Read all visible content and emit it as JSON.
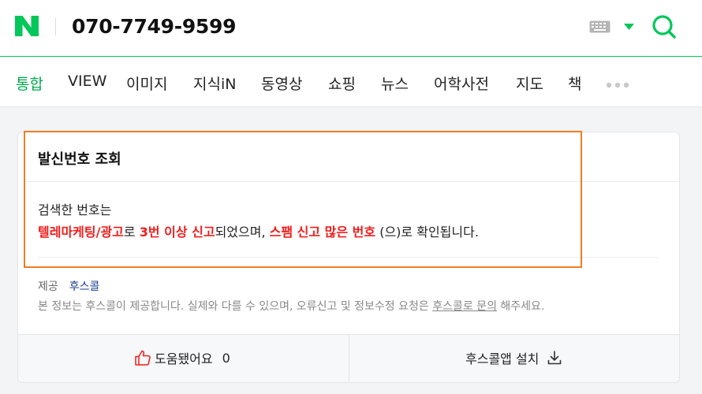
{
  "header": {
    "logo_letter": "N",
    "query": "070-7749-9599",
    "brand_color": "#03c75a"
  },
  "tabs": [
    {
      "label": "통합",
      "active": true
    },
    {
      "label": "VIEW"
    },
    {
      "label": "이미지"
    },
    {
      "label": "지식iN"
    },
    {
      "label": "동영상"
    },
    {
      "label": "쇼핑"
    },
    {
      "label": "뉴스"
    },
    {
      "label": "어학사전"
    },
    {
      "label": "지도"
    },
    {
      "label": "책"
    }
  ],
  "card": {
    "title": "발신번호 조회",
    "line1": "검색한 번호는",
    "line2": {
      "part1": "텔레마케팅/광고",
      "part2": "로 ",
      "part3": "3번 이상 신고",
      "part4": "되었으며, ",
      "part5": "스팸 신고 많은 번호",
      "part6": " (으)로 확인됩니다."
    },
    "provider_label": "제공",
    "provider_name": "후스콜",
    "notice_pre": "본 정보는 후스콜이 제공합니다. 실제와 다를 수 있으며, 오류신고 및 정보수정 요청은 ",
    "notice_link": "후스콜로 문의",
    "notice_post": " 해주세요.",
    "highlight_color": "#ef7d22",
    "warning_color": "#f21d1d"
  },
  "footer": {
    "like_label": "도움됐어요",
    "like_count": "0",
    "install_label": "후스콜앱 설치"
  }
}
